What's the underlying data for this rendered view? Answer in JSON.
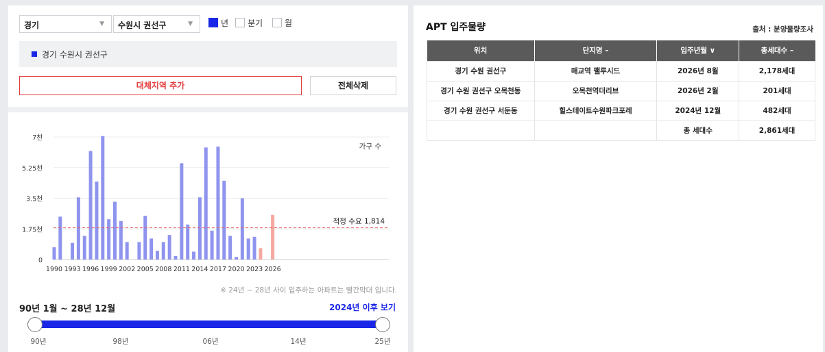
{
  "filters": {
    "region": "경기",
    "city": "수원시 권선구",
    "period_options": [
      {
        "label": "년",
        "checked": true
      },
      {
        "label": "분기",
        "checked": false
      },
      {
        "label": "월",
        "checked": false
      }
    ]
  },
  "selected_region": "경기 수원시 권선구",
  "buttons": {
    "add_region": "대체지역 추가",
    "delete_all": "전체삭제"
  },
  "chart_data": {
    "type": "bar",
    "series_label": "가구 수",
    "yticks": [
      "0",
      "1.75천",
      "3.5천",
      "5.25천",
      "7천"
    ],
    "ylim": [
      0,
      7000
    ],
    "xticks": [
      "1990",
      "1993",
      "1996",
      "1999",
      "2002",
      "2005",
      "2008",
      "2011",
      "2014",
      "2017",
      "2020",
      "2023",
      "2026"
    ],
    "years": [
      1990,
      1991,
      1992,
      1993,
      1994,
      1995,
      1996,
      1997,
      1998,
      1999,
      2000,
      2001,
      2002,
      2003,
      2004,
      2005,
      2006,
      2007,
      2008,
      2009,
      2010,
      2011,
      2012,
      2013,
      2014,
      2015,
      2016,
      2017,
      2018,
      2019,
      2020,
      2021,
      2022,
      2023,
      2024,
      2025,
      2026
    ],
    "values": [
      700,
      2450,
      0,
      950,
      3550,
      1350,
      6200,
      4450,
      7050,
      2300,
      3300,
      2200,
      1000,
      0,
      1000,
      2500,
      1200,
      500,
      1000,
      1400,
      200,
      5500,
      2000,
      450,
      3550,
      6400,
      1650,
      6450,
      4500,
      1350,
      150,
      3500,
      1200,
      1300,
      650,
      0,
      2550
    ],
    "highlight_years": [
      2024,
      2025,
      2026
    ],
    "reference_value": 1814,
    "reference_label": "적정 수요 1,814",
    "colors": {
      "normal": "#8f94ee",
      "highlight": "#f5a8a0",
      "reference": "#e86060"
    },
    "grid": true
  },
  "chart_note": "※ 24년 ~ 28년 사이 입주하는 아파트는 빨간막대 입니다.",
  "range": {
    "label": "90년 1월 ~ 28년 12월",
    "after_link": "2024년 이후 보기",
    "ticks": [
      "90년",
      "98년",
      "06년",
      "14년",
      "25년"
    ]
  },
  "table": {
    "title": "APT 입주물량",
    "source": "출처 : 분양물량조사",
    "headers": [
      "위치",
      "단지명 –",
      "입주년월 ∨",
      "총세대수 –"
    ],
    "rows": [
      [
        "경기 수원 권선구",
        "매교역 팰루시드",
        "2026년 8월",
        "2,178세대"
      ],
      [
        "경기 수원 권선구 오목천동",
        "오목천역더리브",
        "2026년 2월",
        "201세대"
      ],
      [
        "경기 수원 권선구 서둔동",
        "힐스테이트수원파크포레",
        "2024년 12월",
        "482세대"
      ],
      [
        "",
        "",
        "총 세대수",
        "2,861세대"
      ]
    ]
  }
}
